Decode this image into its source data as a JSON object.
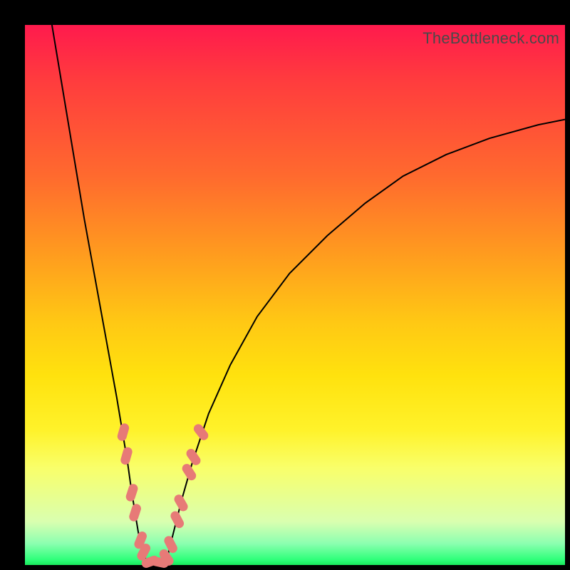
{
  "watermark": "TheBottleneck.com",
  "colors": {
    "frame": "#000000",
    "curve": "#000000",
    "marker": "#e77a77",
    "gradient_top": "#ff1a4d",
    "gradient_bottom": "#18e85c"
  },
  "chart_data": {
    "type": "line",
    "title": "",
    "xlabel": "",
    "ylabel": "",
    "xlim": [
      0,
      100
    ],
    "ylim": [
      0,
      100
    ],
    "series": [
      {
        "name": "left-branch",
        "x": [
          5,
          7,
          9,
          11,
          13,
          15,
          17,
          18,
          19,
          19.7,
          20.5,
          21,
          21.5,
          22,
          22.4,
          22.7
        ],
        "y": [
          100,
          88,
          76,
          64,
          53,
          42,
          31,
          25,
          19,
          14,
          9,
          6,
          4,
          2,
          1,
          0.5
        ]
      },
      {
        "name": "right-branch",
        "x": [
          26,
          26.5,
          27,
          28,
          29,
          31,
          34,
          38,
          43,
          49,
          56,
          63,
          70,
          78,
          86,
          95,
          100
        ],
        "y": [
          0.5,
          2,
          4,
          8,
          12,
          19,
          28,
          37,
          46,
          54,
          61,
          67,
          72,
          76,
          79,
          81.5,
          82.5
        ]
      },
      {
        "name": "valley-floor",
        "x": [
          22.7,
          24.3,
          26
        ],
        "y": [
          0.5,
          0.2,
          0.5
        ]
      }
    ],
    "markers": {
      "name": "highlighted-points",
      "points": [
        {
          "x": 18.2,
          "y": 24.6,
          "angle": -74
        },
        {
          "x": 18.8,
          "y": 20.2,
          "angle": -74
        },
        {
          "x": 19.8,
          "y": 13.4,
          "angle": -72
        },
        {
          "x": 20.4,
          "y": 9.7,
          "angle": -72
        },
        {
          "x": 21.4,
          "y": 4.6,
          "angle": -68
        },
        {
          "x": 22.0,
          "y": 2.4,
          "angle": -62
        },
        {
          "x": 23.2,
          "y": 0.6,
          "angle": -20
        },
        {
          "x": 25.0,
          "y": 0.5,
          "angle": 12
        },
        {
          "x": 26.2,
          "y": 1.4,
          "angle": 55
        },
        {
          "x": 27.0,
          "y": 3.8,
          "angle": 63
        },
        {
          "x": 28.2,
          "y": 8.4,
          "angle": 62
        },
        {
          "x": 28.9,
          "y": 11.5,
          "angle": 60
        },
        {
          "x": 30.4,
          "y": 17.2,
          "angle": 57
        },
        {
          "x": 31.2,
          "y": 20.0,
          "angle": 55
        },
        {
          "x": 32.6,
          "y": 24.6,
          "angle": 52
        }
      ]
    }
  }
}
